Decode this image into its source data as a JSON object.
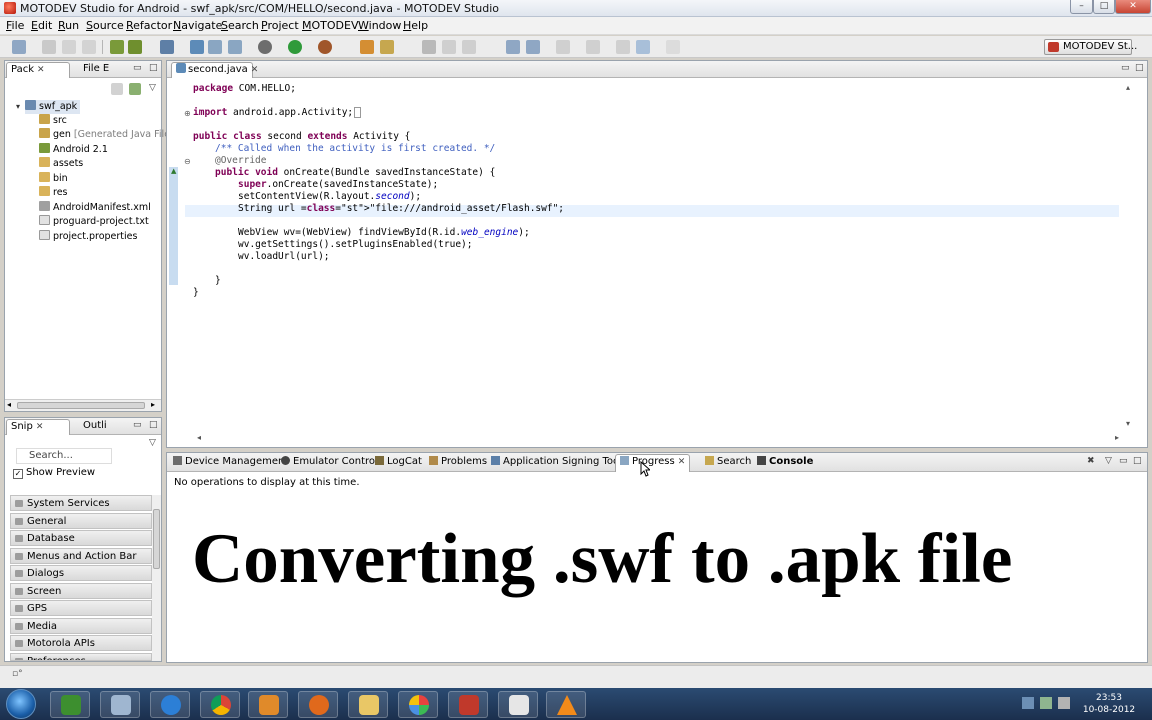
{
  "window": {
    "title": "MOTODEV Studio for Android - swf_apk/src/COM/HELLO/second.java - MOTODEV Studio",
    "controls": {
      "minimize": "–",
      "maximize": "□",
      "close": "✕"
    }
  },
  "menubar": [
    "File",
    "Edit",
    "Run",
    "Source",
    "Refactor",
    "Navigate",
    "Search",
    "Project",
    "MOTODEV",
    "Window",
    "Help"
  ],
  "toolbar": {
    "perspective_label": "MOTODEV St..."
  },
  "package_explorer": {
    "tabs": [
      "Pack",
      "File E"
    ],
    "project": "swf_apk",
    "items": [
      {
        "label": "src",
        "suffix": ""
      },
      {
        "label": "gen",
        "suffix": " [Generated Java Files]"
      },
      {
        "label": "Android 2.1",
        "suffix": ""
      },
      {
        "label": "assets",
        "suffix": ""
      },
      {
        "label": "bin",
        "suffix": ""
      },
      {
        "label": "res",
        "suffix": ""
      },
      {
        "label": "AndroidManifest.xml",
        "suffix": ""
      },
      {
        "label": "proguard-project.txt",
        "suffix": ""
      },
      {
        "label": "project.properties",
        "suffix": ""
      }
    ]
  },
  "snippets": {
    "tabs": [
      "Snip",
      "Outli"
    ],
    "search_placeholder": "Search...",
    "show_preview": "Show Preview",
    "categories": [
      "System Services",
      "General",
      "Database",
      "Menus and Action Bar",
      "Dialogs",
      "Screen",
      "GPS",
      "Media",
      "Motorola APIs",
      "Preferences"
    ]
  },
  "editor": {
    "tab": "second.java",
    "lines": [
      "package COM.HELLO;",
      "import android.app.Activity;",
      "public class second extends Activity {",
      "/** Called when the activity is first created. */",
      "@Override",
      "public void onCreate(Bundle savedInstanceState) {",
      "super.onCreate(savedInstanceState);",
      "setContentView(R.layout.second);",
      "String url =\"file:///android_asset/Flash.swf\";",
      "WebView wv=(WebView) findViewById(R.id.web_engine);",
      "wv.getSettings().setPluginsEnabled(true);",
      "wv.loadUrl(url);",
      "}",
      "}"
    ]
  },
  "bottom_panel": {
    "tabs": [
      "Device Management",
      "Emulator Control",
      "LogCat",
      "Problems",
      "Application Signing Tool",
      "Progress",
      "Search",
      "Console"
    ],
    "active_tab": "Progress",
    "message": "No operations to display at this time.",
    "banner": "Converting .swf to .apk file"
  },
  "taskbar": {
    "time": "23:53",
    "date": "10-08-2012"
  }
}
